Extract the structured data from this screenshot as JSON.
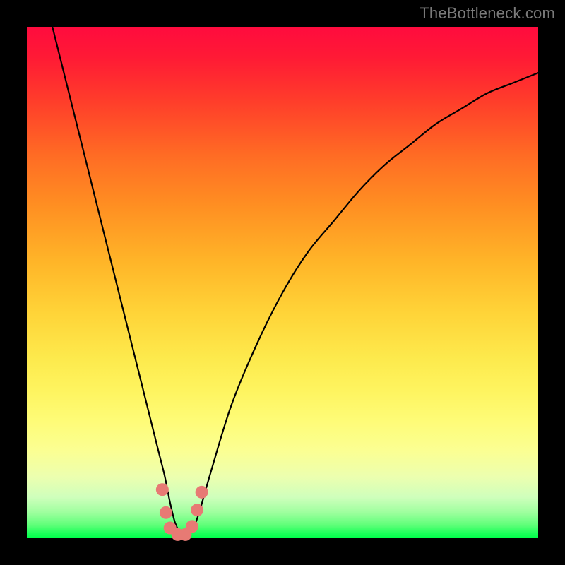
{
  "watermark": "TheBottleneck.com",
  "chart_data": {
    "type": "line",
    "title": "",
    "xlabel": "",
    "ylabel": "",
    "xlim": [
      0,
      100
    ],
    "ylim": [
      0,
      100
    ],
    "series": [
      {
        "name": "bottleneck-curve",
        "x": [
          5,
          7,
          9,
          11,
          13,
          15,
          17,
          19,
          21,
          23,
          25,
          26,
          27,
          28,
          29,
          30,
          31,
          32,
          33,
          34,
          36,
          40,
          45,
          50,
          55,
          60,
          65,
          70,
          75,
          80,
          85,
          90,
          95,
          100
        ],
        "values": [
          100,
          92,
          84,
          76,
          68,
          60,
          52,
          44,
          36,
          28,
          20,
          16,
          12,
          7,
          3,
          1,
          0,
          1,
          3,
          6,
          13,
          26,
          38,
          48,
          56,
          62,
          68,
          73,
          77,
          81,
          84,
          87,
          89,
          91
        ]
      }
    ],
    "markers": [
      {
        "x": 26.5,
        "y": 9.5
      },
      {
        "x": 27.2,
        "y": 5.0
      },
      {
        "x": 28.0,
        "y": 2.0
      },
      {
        "x": 29.5,
        "y": 0.7
      },
      {
        "x": 31.0,
        "y": 0.7
      },
      {
        "x": 32.3,
        "y": 2.3
      },
      {
        "x": 33.3,
        "y": 5.5
      },
      {
        "x": 34.2,
        "y": 9.0
      }
    ],
    "marker_color": "#e77a74",
    "curve_color": "#000000"
  }
}
